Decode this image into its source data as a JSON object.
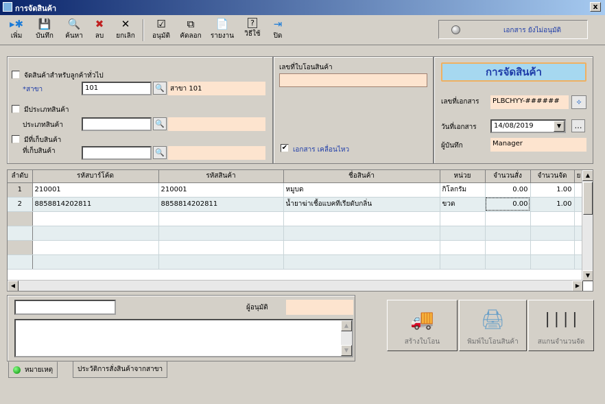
{
  "window": {
    "title": "การจัดสินค้า",
    "close_label": "x"
  },
  "toolbar": {
    "buttons": [
      {
        "label": "เพิ่ม",
        "icon": "▸✱"
      },
      {
        "label": "บันทึก",
        "icon": "💾"
      },
      {
        "label": "ค้นหา",
        "icon": "🔍"
      },
      {
        "label": "ลบ",
        "icon": "✖"
      },
      {
        "label": "ยกเลิก",
        "icon": "✕"
      },
      {
        "label": "อนุมัติ",
        "icon": "☑"
      },
      {
        "label": "คัดลอก",
        "icon": "⧉"
      },
      {
        "label": "รายงาน",
        "icon": "📄"
      },
      {
        "label": "วิธีใช้",
        "icon": "?"
      },
      {
        "label": "ปิด",
        "icon": "⇥"
      }
    ],
    "status_text": "เอกสาร ยังไม่อนุมัติ"
  },
  "filter_panel": {
    "general_customer_label": "จัดสินค้าสำหรับลูกค้าทั่วไป",
    "branch_label": "*สาขา",
    "branch_value": "101",
    "branch_name": "สาขา 101",
    "product_type_checkbox": "มีประเภทสินค้า",
    "product_type_label": "ประเภทสินค้า",
    "product_type_value": "",
    "warehouse_checkbox": "มีที่เก็บสินค้า",
    "warehouse_label": "ที่เก็บสินค้า",
    "warehouse_value": ""
  },
  "transfer_panel": {
    "transfer_no_label": "เลขที่ใบโอนสินค้า",
    "transfer_no_value": "",
    "moving_doc_label": "เอกสาร เคลื่อนไหว",
    "moving_doc_checked": true
  },
  "doc_panel": {
    "heading": "การจัดสินค้า",
    "doc_no_label": "เลขที่เอกสาร",
    "doc_no_value": "PLBCHYY-######",
    "doc_date_label": "วันที่เอกสาร",
    "doc_date_value": "14/08/2019",
    "recorder_label": "ผู้บันทึก",
    "recorder_value": "Manager"
  },
  "grid": {
    "columns": [
      "ลำดับ",
      "รหัสบาร์โค้ด",
      "รหัสสินค้า",
      "ชื่อสินค้า",
      "หน่วย",
      "จำนวนสั่ง",
      "จำนวนจัด",
      "ย"
    ],
    "rows": [
      {
        "idx": "1",
        "barcode": "210001",
        "code": "210001",
        "name": "หมูบด",
        "unit": "กิโลกรัม",
        "ordered": "0.00",
        "picked": "1.00"
      },
      {
        "idx": "2",
        "barcode": "8858814202811",
        "code": "8858814202811",
        "name": "น้ำยาฆ่าเชื้อแบคทีเรียดับกลิ่น",
        "unit": "ขวด",
        "ordered": "0.00",
        "picked": "1.00"
      }
    ],
    "empty_rows": 4
  },
  "bottom": {
    "search_value": "",
    "approver_label": "ผู้อนุมัติ",
    "approver_value": "",
    "note_value": "",
    "btn_create_transfer": "สร้างใบโอน",
    "btn_print_transfer": "พิมพ์ใบโอนสินค้า",
    "btn_scan_qty": "สแกนจำนวนจัด",
    "tab_notes": "หมายเหตุ",
    "tab_history": "ประวัติการสั่งสินค้าจากสาขา"
  },
  "colors": {
    "title_start": "#0a246a",
    "heading_text": "#1e3ca8",
    "peach": "#fde4cf",
    "heading_bg": "#a6d8f0"
  }
}
